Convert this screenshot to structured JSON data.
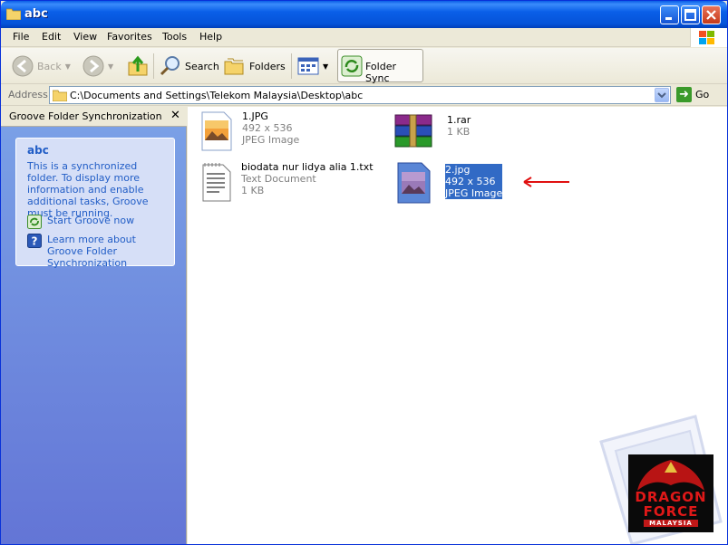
{
  "window": {
    "title": "abc"
  },
  "menu": [
    "File",
    "Edit",
    "View",
    "Favorites",
    "Tools",
    "Help"
  ],
  "toolbar": {
    "back": "Back",
    "search": "Search",
    "folders": "Folders",
    "foldersync": "Folder Sync"
  },
  "address": {
    "label": "Address",
    "path": "C:\\Documents and Settings\\Telekom Malaysia\\Desktop\\abc",
    "go": "Go"
  },
  "leftpane": {
    "header": "Groove Folder Synchronization",
    "close": "✕",
    "box_title": "abc",
    "box_desc": "This is a synchronized folder. To display more information and enable additional tasks, Groove must be running.",
    "link_start": "Start Groove now",
    "link_learn": "Learn more about Groove Folder Synchronization"
  },
  "files": [
    {
      "name": "1.JPG",
      "line2": "492 x 536",
      "line3": "JPEG Image"
    },
    {
      "name": "1.rar",
      "line2": "1 KB",
      "line3": ""
    },
    {
      "name": "biodata nur lidya alia 1.txt",
      "line2": "Text Document",
      "line3": "1 KB"
    },
    {
      "name": "2.jpg",
      "line2": "492 x 536",
      "line3": "JPEG Image"
    }
  ],
  "logo": {
    "line1": "DRAGON",
    "line2": "FORCE",
    "line3": "MALAYSIA"
  },
  "colors": {
    "selection": "#316ac5",
    "arrow": "#e01010",
    "pane": "#6f8fe0"
  }
}
